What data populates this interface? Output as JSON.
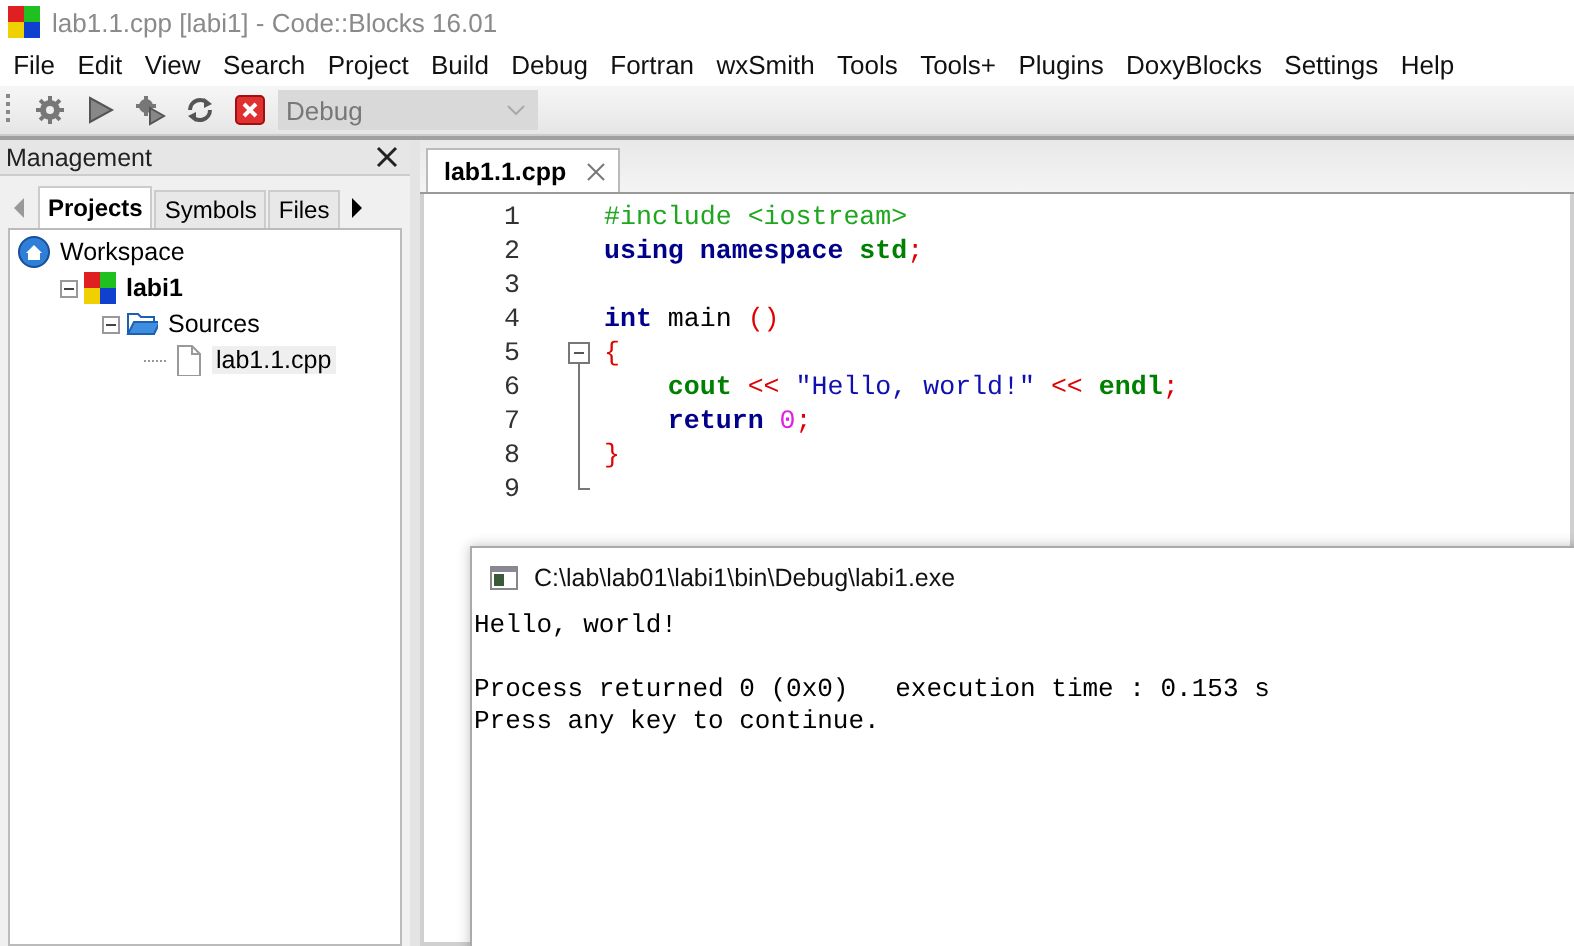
{
  "window": {
    "title": "lab1.1.cpp [labi1] - Code::Blocks 16.01"
  },
  "menu": [
    "File",
    "Edit",
    "View",
    "Search",
    "Project",
    "Build",
    "Debug",
    "Fortran",
    "wxSmith",
    "Tools",
    "Tools+",
    "Plugins",
    "DoxyBlocks",
    "Settings",
    "Help"
  ],
  "toolbar": {
    "buttons": [
      {
        "kind": "build"
      },
      {
        "kind": "run"
      },
      {
        "kind": "build_run"
      },
      {
        "kind": "rebuild"
      },
      {
        "kind": "abort"
      }
    ],
    "target": {
      "value": "Debug",
      "disabled": true
    }
  },
  "management": {
    "title": "Management",
    "tabs": [
      {
        "label": "Projects",
        "selected": true
      },
      {
        "label": "Symbols",
        "selected": false
      },
      {
        "label": "Files",
        "selected": false
      }
    ],
    "tree": [
      {
        "label": "Workspace",
        "kind": "workspace",
        "selected": false,
        "children": [
          {
            "label": "labi1",
            "kind": "project",
            "active": true,
            "expanded": true,
            "selected": false,
            "children": [
              {
                "label": "Sources",
                "kind": "folder",
                "expanded": true,
                "selected": false,
                "children": [
                  {
                    "label": "lab1.1.cpp",
                    "kind": "file",
                    "selected": true
                  }
                ]
              }
            ]
          }
        ]
      }
    ]
  },
  "editor": {
    "tabs": [
      {
        "label": "lab1.1.cpp",
        "selected": true
      }
    ],
    "lines": [
      {
        "number": "1",
        "kind": "plain",
        "tokens": [
          {
            "kind": "preprocessor",
            "text": "#include <iostream>"
          }
        ]
      },
      {
        "number": "2",
        "kind": "plain",
        "tokens": [
          {
            "kind": "keyword",
            "text": "using namespace "
          },
          {
            "kind": "identifier",
            "text": "std"
          },
          {
            "kind": "operator",
            "text": ";"
          }
        ]
      },
      {
        "number": "3",
        "kind": "plain"
      },
      {
        "number": "4",
        "kind": "plain",
        "tokens": [
          {
            "kind": "keyword",
            "text": "int "
          },
          {
            "kind": "plain",
            "text": "main "
          },
          {
            "kind": "operator",
            "text": "()"
          }
        ]
      },
      {
        "number": "5",
        "kind": "fold_start",
        "tokens": [
          {
            "kind": "operator",
            "text": "{"
          }
        ]
      },
      {
        "number": "6",
        "kind": "fold_body",
        "tokens": [
          {
            "kind": "identifier",
            "text": "    cout "
          },
          {
            "kind": "operator",
            "text": "<< "
          },
          {
            "kind": "string",
            "text": "\"Hello, world!\" "
          },
          {
            "kind": "operator",
            "text": "<< "
          },
          {
            "kind": "identifier",
            "text": "endl"
          },
          {
            "kind": "operator",
            "text": ";"
          }
        ]
      },
      {
        "number": "7",
        "kind": "fold_body",
        "tokens": [
          {
            "kind": "keyword",
            "text": "    return "
          },
          {
            "kind": "number",
            "text": "0"
          },
          {
            "kind": "operator",
            "text": ";"
          }
        ]
      },
      {
        "number": "8",
        "kind": "fold_body",
        "tokens": [
          {
            "kind": "operator",
            "text": "}"
          }
        ]
      },
      {
        "number": "9",
        "kind": "fold_end"
      }
    ]
  },
  "console": {
    "title": "C:\\lab\\lab01\\labi1\\bin\\Debug\\labi1.exe",
    "blocks": [
      [
        "Hello, world!"
      ],
      [
        "Process returned 0 (0x0)   execution time : 0.153 s",
        "Press any key to continue."
      ]
    ]
  }
}
